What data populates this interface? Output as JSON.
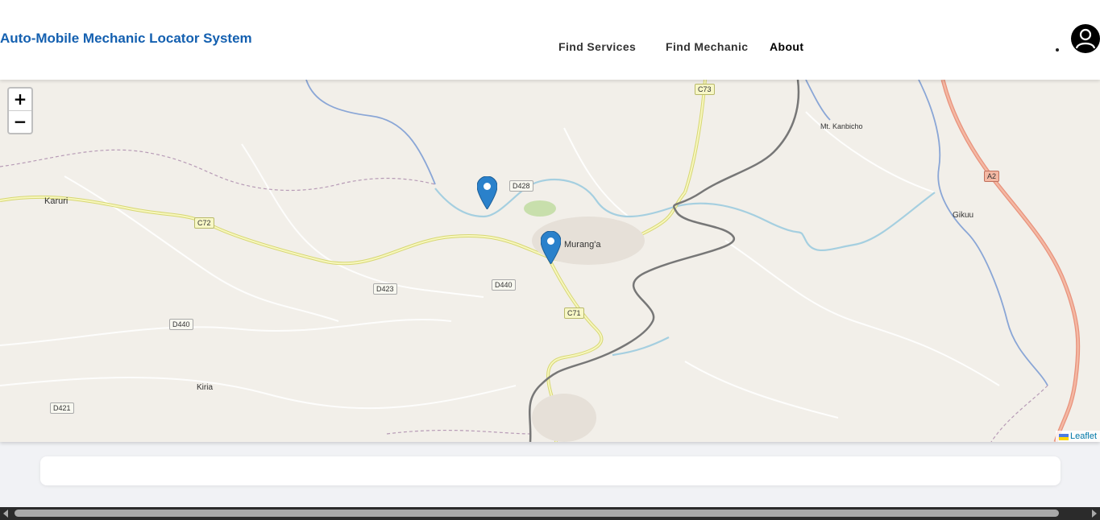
{
  "header": {
    "title": "Auto-Mobile Mechanic Locator System",
    "nav": [
      {
        "label": "Find Services"
      },
      {
        "label": "Find Mechanic"
      },
      {
        "label": "About"
      }
    ]
  },
  "map": {
    "zoom_in": "+",
    "zoom_out": "−",
    "attribution": "Leaflet",
    "places": [
      "Karuri",
      "Murang'a",
      "Kiria",
      "Gikuu",
      "Mt. Kanbicho"
    ],
    "roads": [
      "C72",
      "C73",
      "C71",
      "D428",
      "D423",
      "D440",
      "D440",
      "D421",
      "A2"
    ],
    "markers": [
      "marker-1",
      "marker-2"
    ]
  },
  "colors": {
    "brand": "#1460b0",
    "marker": "#2a81cb",
    "map_bg": "#f2efe9"
  }
}
